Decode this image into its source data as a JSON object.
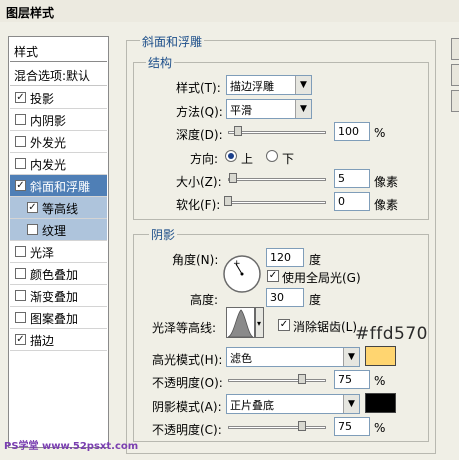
{
  "title": "图层样式",
  "styles_panel": {
    "header": "样式",
    "blend_options": "混合选项:默认",
    "items": [
      {
        "label": "投影",
        "checked": true
      },
      {
        "label": "内阴影",
        "checked": false
      },
      {
        "label": "外发光",
        "checked": false
      },
      {
        "label": "内发光",
        "checked": false
      },
      {
        "label": "斜面和浮雕",
        "checked": true
      },
      {
        "label": "等高线",
        "checked": true
      },
      {
        "label": "纹理",
        "checked": false
      },
      {
        "label": "光泽",
        "checked": false
      },
      {
        "label": "颜色叠加",
        "checked": false
      },
      {
        "label": "渐变叠加",
        "checked": false
      },
      {
        "label": "图案叠加",
        "checked": false
      },
      {
        "label": "描边",
        "checked": true
      }
    ]
  },
  "section_title": "斜面和浮雕",
  "structure": {
    "legend": "结构",
    "style_label": "样式(T):",
    "style_value": "描边浮雕",
    "technique_label": "方法(Q):",
    "technique_value": "平滑",
    "depth_label": "深度(D):",
    "depth_value": "100",
    "depth_unit": "%",
    "depth_level": 0.1,
    "direction_label": "方向:",
    "direction_up": "上",
    "direction_down": "下",
    "direction_selected": "上",
    "size_label": "大小(Z):",
    "size_value": "5",
    "size_unit": "像素",
    "soften_label": "软化(F):",
    "soften_value": "0",
    "soften_unit": "像素"
  },
  "shading": {
    "legend": "阴影",
    "angle_label": "角度(N):",
    "angle_value": "120",
    "angle_unit": "度",
    "global_light_label": "使用全局光(G)",
    "global_light_checked": true,
    "altitude_label": "高度:",
    "altitude_value": "30",
    "altitude_unit": "度",
    "gloss_contour_label": "光泽等高线:",
    "anti_alias_label": "消除锯齿(L)",
    "anti_alias_checked": true,
    "highlight_mode_label": "高光模式(H):",
    "highlight_mode_value": "滤色",
    "highlight_color": "#ffd570",
    "highlight_color_text": "#ffd570",
    "highlight_opacity_label": "不透明度(O):",
    "highlight_opacity_value": "75",
    "highlight_opacity_unit": "%",
    "highlight_opacity_level": 0.75,
    "shadow_mode_label": "阴影模式(A):",
    "shadow_mode_value": "正片叠底",
    "shadow_color": "#000000",
    "shadow_opacity_label": "不透明度(C):",
    "shadow_opacity_value": "75",
    "shadow_opacity_unit": "%",
    "shadow_opacity_level": 0.75
  },
  "watermark": "PS学堂 www.52psxt.com"
}
